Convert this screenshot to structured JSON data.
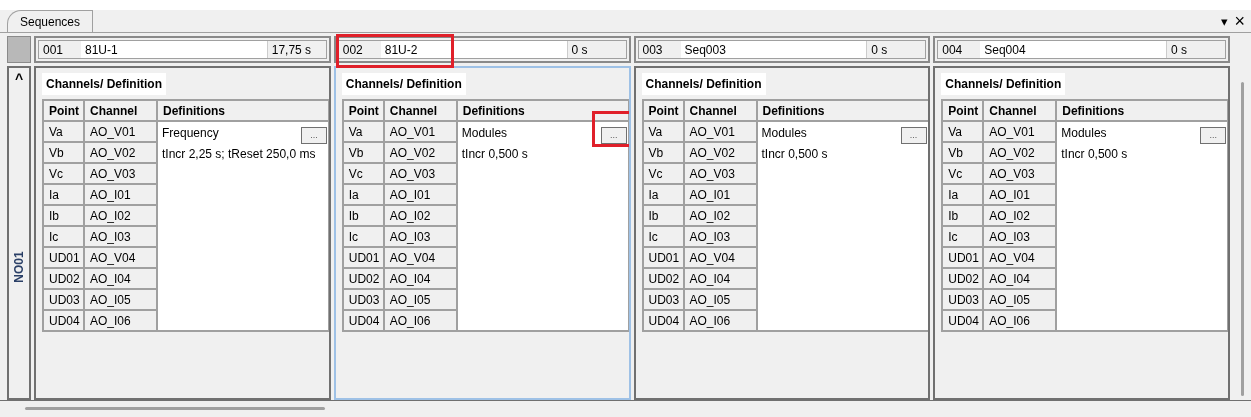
{
  "tab": {
    "label": "Sequences",
    "selected": true
  },
  "window_buttons": {
    "dropdown": "▾",
    "close": "×"
  },
  "group_label": "NO01",
  "collapse_button": "^",
  "sequences": [
    {
      "number": "001",
      "name": "81U-1",
      "duration": "17,75 s",
      "selected": false,
      "highlighted": false,
      "section_title": "Channels/ Definition",
      "columns": [
        "Point",
        "Channel",
        "Definitions"
      ],
      "definitions": [
        {
          "text": "Frequency",
          "button": "...",
          "button_highlighted": false
        },
        {
          "text": "tIncr 2,25 s; tReset 250,0 ms"
        }
      ],
      "rows": [
        {
          "point": "Va",
          "channel": "AO_V01"
        },
        {
          "point": "Vb",
          "channel": "AO_V02"
        },
        {
          "point": "Vc",
          "channel": "AO_V03"
        },
        {
          "point": "Ia",
          "channel": "AO_I01"
        },
        {
          "point": "Ib",
          "channel": "AO_I02"
        },
        {
          "point": "Ic",
          "channel": "AO_I03"
        },
        {
          "point": "UD01",
          "channel": "AO_V04"
        },
        {
          "point": "UD02",
          "channel": "AO_I04"
        },
        {
          "point": "UD03",
          "channel": "AO_I05"
        },
        {
          "point": "UD04",
          "channel": "AO_I06"
        }
      ]
    },
    {
      "number": "002",
      "name": "81U-2",
      "duration": "0 s",
      "selected": true,
      "highlighted": true,
      "section_title": "Channels/ Definition",
      "columns": [
        "Point",
        "Channel",
        "Definitions"
      ],
      "definitions": [
        {
          "text": "Modules",
          "button": "...",
          "button_highlighted": true
        },
        {
          "text": "tIncr 0,500 s"
        }
      ],
      "rows": [
        {
          "point": "Va",
          "channel": "AO_V01"
        },
        {
          "point": "Vb",
          "channel": "AO_V02"
        },
        {
          "point": "Vc",
          "channel": "AO_V03"
        },
        {
          "point": "Ia",
          "channel": "AO_I01"
        },
        {
          "point": "Ib",
          "channel": "AO_I02"
        },
        {
          "point": "Ic",
          "channel": "AO_I03"
        },
        {
          "point": "UD01",
          "channel": "AO_V04"
        },
        {
          "point": "UD02",
          "channel": "AO_I04"
        },
        {
          "point": "UD03",
          "channel": "AO_I05"
        },
        {
          "point": "UD04",
          "channel": "AO_I06"
        }
      ]
    },
    {
      "number": "003",
      "name": "Seq003",
      "duration": "0 s",
      "selected": false,
      "highlighted": false,
      "section_title": "Channels/ Definition",
      "columns": [
        "Point",
        "Channel",
        "Definitions"
      ],
      "definitions": [
        {
          "text": "Modules",
          "button": "...",
          "button_highlighted": false
        },
        {
          "text": "tIncr 0,500 s"
        }
      ],
      "rows": [
        {
          "point": "Va",
          "channel": "AO_V01"
        },
        {
          "point": "Vb",
          "channel": "AO_V02"
        },
        {
          "point": "Vc",
          "channel": "AO_V03"
        },
        {
          "point": "Ia",
          "channel": "AO_I01"
        },
        {
          "point": "Ib",
          "channel": "AO_I02"
        },
        {
          "point": "Ic",
          "channel": "AO_I03"
        },
        {
          "point": "UD01",
          "channel": "AO_V04"
        },
        {
          "point": "UD02",
          "channel": "AO_I04"
        },
        {
          "point": "UD03",
          "channel": "AO_I05"
        },
        {
          "point": "UD04",
          "channel": "AO_I06"
        }
      ]
    },
    {
      "number": "004",
      "name": "Seq004",
      "duration": "0 s",
      "selected": false,
      "highlighted": false,
      "section_title": "Channels/ Definition",
      "columns": [
        "Point",
        "Channel",
        "Definitions"
      ],
      "definitions": [
        {
          "text": "Modules",
          "button": "...",
          "button_highlighted": false
        },
        {
          "text": "tIncr 0,500 s"
        }
      ],
      "rows": [
        {
          "point": "Va",
          "channel": "AO_V01"
        },
        {
          "point": "Vb",
          "channel": "AO_V02"
        },
        {
          "point": "Vc",
          "channel": "AO_V03"
        },
        {
          "point": "Ia",
          "channel": "AO_I01"
        },
        {
          "point": "Ib",
          "channel": "AO_I02"
        },
        {
          "point": "Ic",
          "channel": "AO_I03"
        },
        {
          "point": "UD01",
          "channel": "AO_V04"
        },
        {
          "point": "UD02",
          "channel": "AO_I04"
        },
        {
          "point": "UD03",
          "channel": "AO_I05"
        },
        {
          "point": "UD04",
          "channel": "AO_I06"
        }
      ]
    }
  ]
}
